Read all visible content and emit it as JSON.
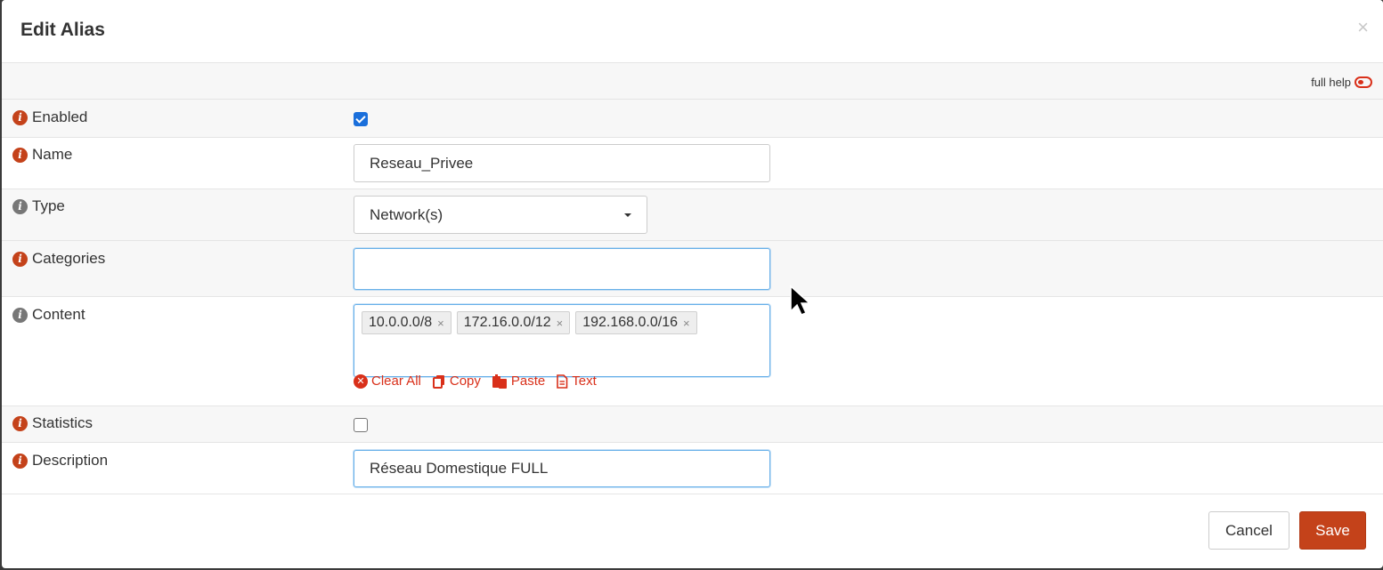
{
  "dialog": {
    "title": "Edit Alias",
    "close": "×",
    "full_help": "full help"
  },
  "fields": {
    "enabled": {
      "label": "Enabled",
      "checked": true
    },
    "name": {
      "label": "Name",
      "value": "Reseau_Privee"
    },
    "type": {
      "label": "Type",
      "value": "Network(s)"
    },
    "categories": {
      "label": "Categories",
      "value": ""
    },
    "content": {
      "label": "Content",
      "tags": [
        "10.0.0.0/8",
        "172.16.0.0/12",
        "192.168.0.0/16"
      ],
      "tag_remove": "×",
      "actions": {
        "clear_all": "Clear All",
        "copy": "Copy",
        "paste": "Paste",
        "text": "Text"
      }
    },
    "statistics": {
      "label": "Statistics",
      "checked": false
    },
    "description": {
      "label": "Description",
      "value": "Réseau Domestique FULL"
    }
  },
  "buttons": {
    "cancel": "Cancel",
    "save": "Save"
  },
  "colors": {
    "accent": "#c4421a",
    "link": "#d9301a",
    "checkbox": "#1a6fdb"
  }
}
